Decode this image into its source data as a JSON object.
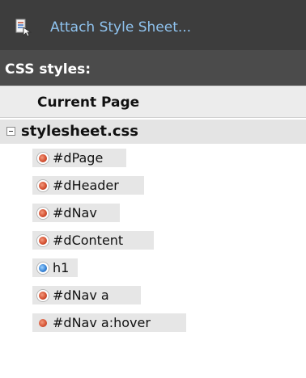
{
  "toolbar": {
    "attach_label": "Attach Style Sheet...",
    "attach_icon": "attach-stylesheet-icon"
  },
  "panel": {
    "title": "CSS styles:",
    "current_page_label": "Current Page"
  },
  "stylesheet": {
    "name": "stylesheet.css",
    "expanded": true,
    "rules": [
      {
        "selector": "#dPage",
        "icon": "id-rule-icon",
        "color": "#d55233"
      },
      {
        "selector": "#dHeader",
        "icon": "id-rule-icon",
        "color": "#d55233"
      },
      {
        "selector": "#dNav",
        "icon": "id-rule-icon",
        "color": "#d55233"
      },
      {
        "selector": "#dContent",
        "icon": "id-rule-icon",
        "color": "#d55233"
      },
      {
        "selector": "h1",
        "icon": "element-rule-icon",
        "color": "#3a86d8"
      },
      {
        "selector": "#dNav a",
        "icon": "id-rule-icon",
        "color": "#d55233"
      },
      {
        "selector": "#dNav a:hover",
        "icon": "id-rule-icon",
        "color": "#d55233"
      }
    ]
  }
}
